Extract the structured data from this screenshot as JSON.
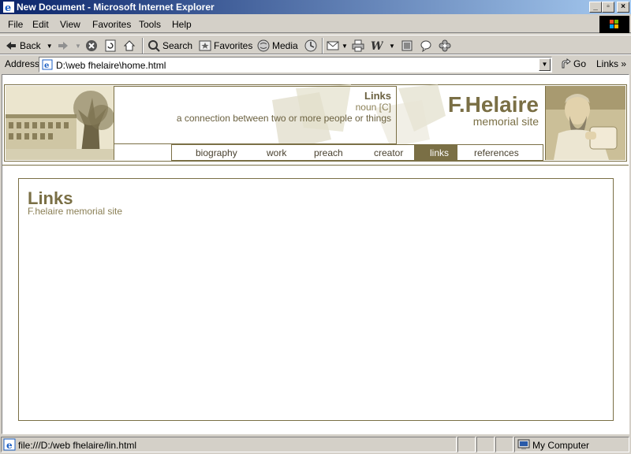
{
  "window": {
    "title": "New Document - Microsoft Internet Explorer",
    "controls": {
      "minimize": "_",
      "maximize": "▫",
      "close": "×"
    }
  },
  "menu": [
    "File",
    "Edit",
    "View",
    "Favorites",
    "Tools",
    "Help"
  ],
  "toolbar": {
    "back": "Back",
    "search": "Search",
    "favorites": "Favorites",
    "media": "Media"
  },
  "address": {
    "label": "Address",
    "value": "D:\\web fhelaire\\home.html",
    "go": "Go",
    "links": "Links"
  },
  "page": {
    "definition": {
      "word": "Links",
      "part_of_speech": "noun [C]",
      "meaning": "a connection between two or more people or things"
    },
    "brand": {
      "name": "F.Helaire",
      "tagline": "memorial site"
    },
    "nav": [
      {
        "label": "biography",
        "active": false
      },
      {
        "label": "work",
        "active": false
      },
      {
        "label": "preach",
        "active": false
      },
      {
        "label": "creator",
        "active": false
      },
      {
        "label": "links",
        "active": true
      },
      {
        "label": "references",
        "active": false
      }
    ],
    "panel": {
      "heading": "Links",
      "subheading": "F.helaire memorial site"
    },
    "accent_color": "#7a6f45"
  },
  "status": {
    "text": "file:///D:/web fhelaire/lin.html",
    "zone": "My Computer"
  }
}
